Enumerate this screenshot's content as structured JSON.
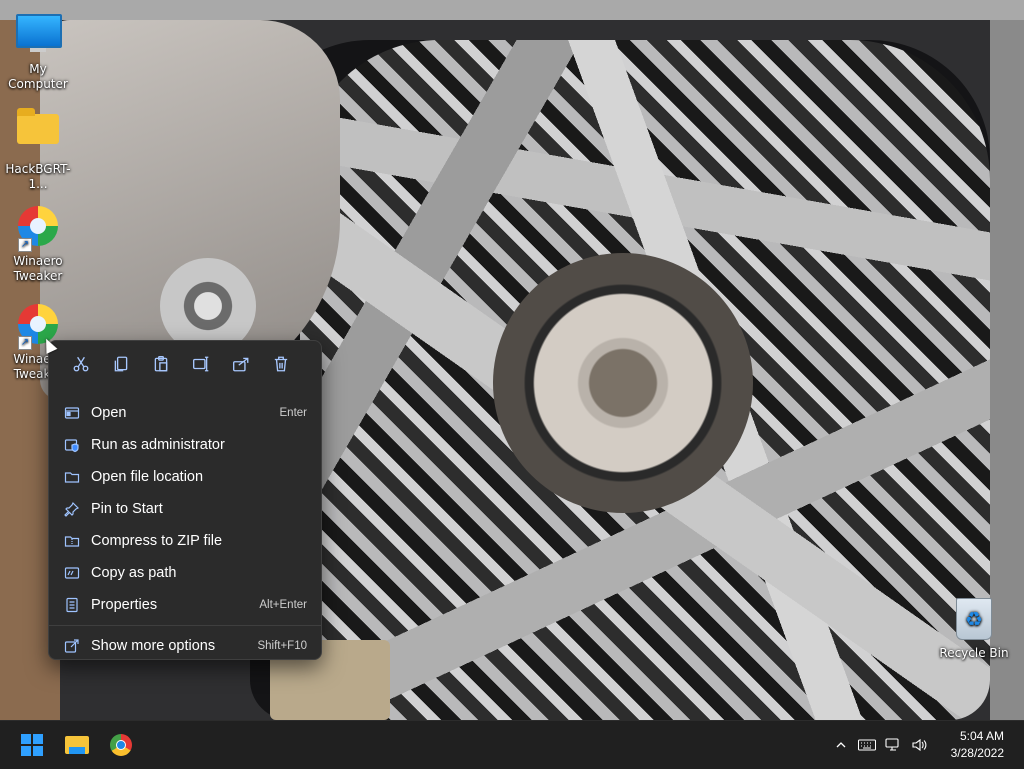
{
  "desktop": {
    "icons": [
      {
        "label": "My Computer",
        "icon": "computer-icon"
      },
      {
        "label": "HackBGRT-1...",
        "icon": "folder-icon"
      },
      {
        "label": "Winaero Tweaker",
        "icon": "winaero-icon"
      },
      {
        "label": "Winaero Tweaker",
        "icon": "winaero-icon"
      },
      {
        "label": "Recycle Bin",
        "icon": "recycle-bin-icon"
      }
    ],
    "second_icon_label_visible": "Winaero Tweak"
  },
  "context_menu": {
    "quick_actions": [
      {
        "name": "cut",
        "icon": "scissors-icon"
      },
      {
        "name": "copy",
        "icon": "copy-icon"
      },
      {
        "name": "paste",
        "icon": "paste-icon"
      },
      {
        "name": "rename",
        "icon": "rename-icon"
      },
      {
        "name": "share",
        "icon": "share-icon"
      },
      {
        "name": "delete",
        "icon": "trash-icon"
      }
    ],
    "items": [
      {
        "label": "Open",
        "shortcut": "Enter",
        "icon": "open-icon"
      },
      {
        "label": "Run as administrator",
        "shortcut": "",
        "icon": "shield-icon"
      },
      {
        "label": "Open file location",
        "shortcut": "",
        "icon": "folder-icon"
      },
      {
        "label": "Pin to Start",
        "shortcut": "",
        "icon": "pin-icon"
      },
      {
        "label": "Compress to ZIP file",
        "shortcut": "",
        "icon": "zip-icon"
      },
      {
        "label": "Copy as path",
        "shortcut": "",
        "icon": "path-icon"
      },
      {
        "label": "Properties",
        "shortcut": "Alt+Enter",
        "icon": "properties-icon"
      },
      {
        "label": "Show more options",
        "shortcut": "Shift+F10",
        "icon": "more-options-icon"
      }
    ]
  },
  "taskbar": {
    "pinned": [
      {
        "name": "start",
        "icon": "windows-start-icon"
      },
      {
        "name": "file-explorer",
        "icon": "file-explorer-icon"
      },
      {
        "name": "chrome",
        "icon": "chrome-icon"
      }
    ],
    "tray": {
      "chevron": "^",
      "icons": [
        "keyboard-icon",
        "network-icon",
        "volume-icon"
      ]
    },
    "clock": {
      "time": "5:04 AM",
      "date": "3/28/2022"
    }
  },
  "colors": {
    "menu_bg": "#2b2b2b",
    "accent": "#2fa0ff",
    "taskbar_bg": "#202020"
  }
}
